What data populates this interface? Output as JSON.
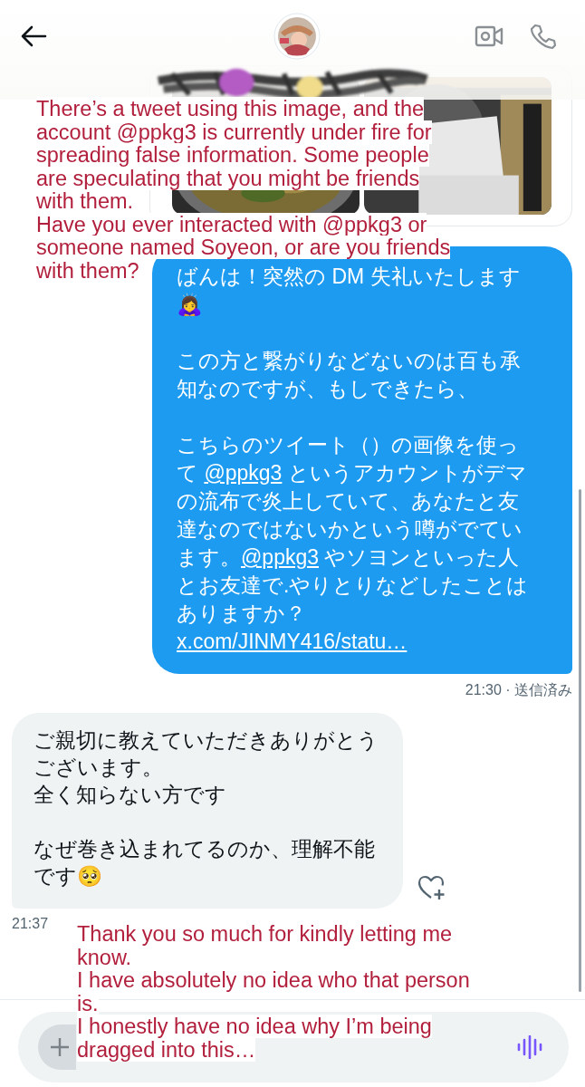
{
  "messages": [
    {
      "kind": "sent",
      "paragraphs": [
        [
          {
            "kind": "text",
            "text": "ばんは！突然の DM 失礼いたします🙇‍♀️"
          }
        ],
        [
          {
            "kind": "text",
            "text": "この方と繋がりなどないのは百も承知なのですが、もしできたら、"
          }
        ],
        [
          {
            "kind": "text",
            "text": "こちらのツイート（）の画像を使って "
          },
          {
            "kind": "mention",
            "text": "@ppkg3"
          },
          {
            "kind": "text",
            "text": " というアカウントがデマの流布で炎上していて、あなたと友達なのではないかという噂がでています。"
          },
          {
            "kind": "mention",
            "text": "@ppkg3"
          },
          {
            "kind": "text",
            "text": " やソヨンといった人とお友達で.やりとりなどしたことはありますか？ "
          },
          {
            "kind": "link",
            "text": "x.com/JINMY416/statu…"
          }
        ]
      ],
      "meta": "21:30 · 送信済み"
    },
    {
      "kind": "received",
      "paragraphs": [
        [
          {
            "kind": "text",
            "text": "ご親切に教えていただきありがとうございます。"
          },
          {
            "kind": "text",
            "text": "全く知らない方です"
          }
        ],
        [
          {
            "kind": "text",
            "text": "なぜ巻き込まれてるのか、理解不能です🥺"
          }
        ]
      ],
      "meta": "21:37"
    }
  ],
  "translations": [
    {
      "paragraphs": [
        "There’s a tweet using this image, and the account @ppkg3 is currently under fire for spreading false information. Some people are speculating that you might be friends with them.",
        "Have you ever interacted with @ppkg3 or someone named Soyeon, or are you friends with them?"
      ]
    },
    {
      "paragraphs": [
        "Thank you so much for kindly letting me know.",
        "I have absolutely no idea who that person is.",
        "I honestly have no idea why I’m being dragged into this…"
      ]
    }
  ]
}
